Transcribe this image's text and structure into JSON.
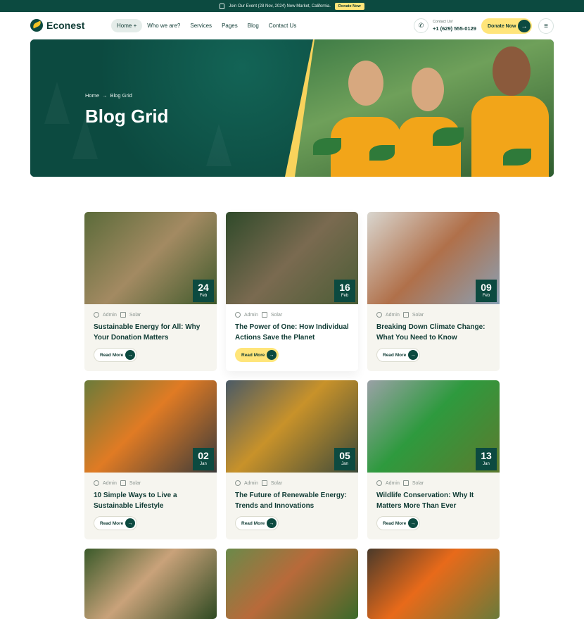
{
  "topbar": {
    "announcement": "Join Our Event (28 Nov, 2024) New Market, California.",
    "cta": "Donate Now"
  },
  "brand": {
    "name": "Econest"
  },
  "nav": {
    "items": [
      {
        "label": "Home +",
        "active": true
      },
      {
        "label": "Who we are?"
      },
      {
        "label": "Services"
      },
      {
        "label": "Pages"
      },
      {
        "label": "Blog"
      },
      {
        "label": "Contact Us"
      }
    ],
    "contact_label": "Contact Us!",
    "phone": "+1 (629) 555-0129",
    "donate": "Donate Now"
  },
  "hero": {
    "breadcrumb": {
      "home": "Home",
      "sep": "→",
      "current": "Blog Grid"
    },
    "title": "Blog Grid"
  },
  "posts": [
    {
      "day": "24",
      "month": "Feb",
      "author": "Admin",
      "category": "Solar",
      "title": "Sustainable Energy for All: Why Your Donation Matters",
      "read_more": "Read More"
    },
    {
      "day": "16",
      "month": "Feb",
      "author": "Admin",
      "category": "Solar",
      "title": "The Power of One: How Individual Actions Save the Planet",
      "read_more": "Read More"
    },
    {
      "day": "09",
      "month": "Feb",
      "author": "Admin",
      "category": "Solar",
      "title": "Breaking Down Climate Change: What You Need to Know",
      "read_more": "Read More"
    },
    {
      "day": "02",
      "month": "Jan",
      "author": "Admin",
      "category": "Solar",
      "title": "10 Simple Ways to Live a Sustainable Lifestyle",
      "read_more": "Read More"
    },
    {
      "day": "05",
      "month": "Jan",
      "author": "Admin",
      "category": "Solar",
      "title": "The Future of Renewable Energy: Trends and Innovations",
      "read_more": "Read More"
    },
    {
      "day": "13",
      "month": "Jan",
      "author": "Admin",
      "category": "Solar",
      "title": "Wildlife Conservation: Why It Matters More Than Ever",
      "read_more": "Read More"
    }
  ],
  "colors": {
    "primary": "#0c4a40",
    "accent": "#ffe57a",
    "card_bg": "#f6f5ef"
  }
}
